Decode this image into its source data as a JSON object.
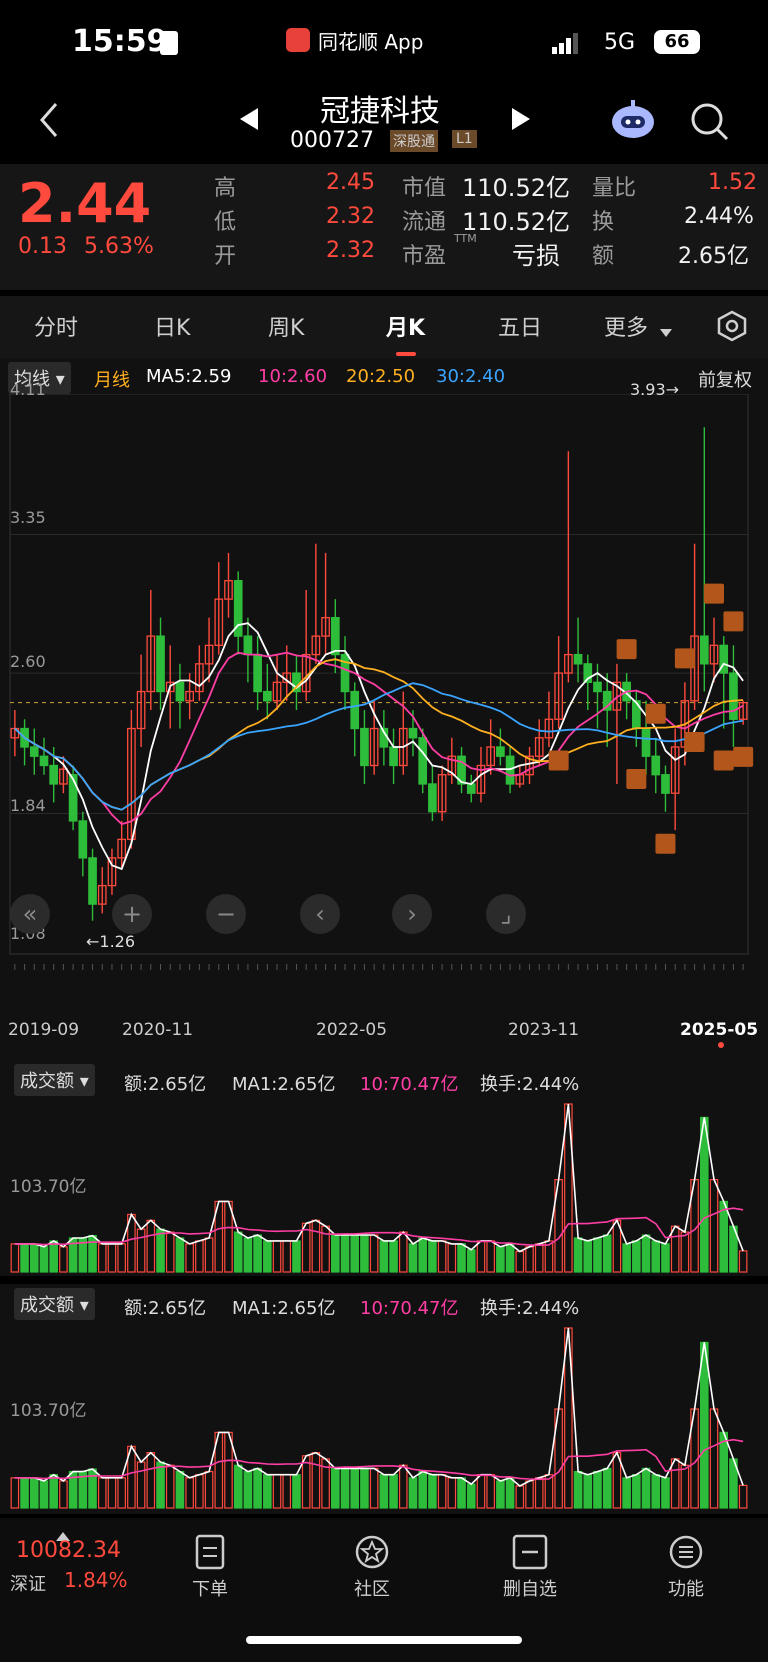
{
  "status_bar": {
    "time": "15:59",
    "app_label": "同花顺 App",
    "network": "5G",
    "battery": "66"
  },
  "header": {
    "title": "冠捷科技",
    "code": "000727",
    "tag1": "深股通",
    "tag2": "L1"
  },
  "quote": {
    "price": "2.44",
    "change": "0.13",
    "change_pct": "5.63%",
    "high_label": "高",
    "high": "2.45",
    "low_label": "低",
    "low": "2.32",
    "open_label": "开",
    "open": "2.32",
    "mktcap_label": "市值",
    "mktcap": "110.52亿",
    "float_label": "流通",
    "float": "110.52亿",
    "pe_label": "市盈",
    "pe_sup": "TTM",
    "pe": "亏损",
    "vol_ratio_label": "量比",
    "vol_ratio": "1.52",
    "turnover_label": "换",
    "turnover": "2.44%",
    "amount_label": "额",
    "amount": "2.65亿"
  },
  "tabs": [
    "分时",
    "日K",
    "周K",
    "月K",
    "五日",
    "更多"
  ],
  "active_tab": "月K",
  "chart_bar": {
    "selector": "均线",
    "period": "月线",
    "ma5": "MA5:2.59",
    "ma10": "10:2.60",
    "ma20": "20:2.50",
    "ma30": "30:2.40",
    "adjust": "前复权"
  },
  "price_axis": [
    "4.11",
    "3.35",
    "2.60",
    "1.84",
    "1.08"
  ],
  "annotations": {
    "max": "3.93→",
    "min": "←1.26"
  },
  "date_axis": [
    "2019-09",
    "2020-11",
    "2022-05",
    "2023-11",
    "2025-05"
  ],
  "volume_panels": [
    {
      "selector": "成交额",
      "amount": "额:2.65亿",
      "ma1": "MA1:2.65亿",
      "ma10": "10:70.47亿",
      "turnover": "换手:2.44%",
      "axis": "103.70亿"
    },
    {
      "selector": "成交额",
      "amount": "额:2.65亿",
      "ma1": "MA1:2.65亿",
      "ma10": "10:70.47亿",
      "turnover": "换手:2.44%",
      "axis": "103.70亿"
    }
  ],
  "bottom_nav": {
    "index_value": "10082.34",
    "index_name": "深证",
    "index_pct": "1.84%",
    "items": [
      "下单",
      "社区",
      "删自选",
      "功能"
    ]
  },
  "colors": {
    "up": "#ff4a3d",
    "down": "#2ebd3a",
    "ma5": "#ffffff",
    "ma10": "#ff3ea5",
    "ma20": "#ffb020",
    "ma30": "#3aa4ff",
    "trade": "#b3561c"
  },
  "chart_data": {
    "type": "candlestick",
    "period": "monthly",
    "x_range": [
      "2019-09",
      "2025-05"
    ],
    "ylim": [
      1.08,
      4.11
    ],
    "y_ticks": [
      4.11,
      3.35,
      2.6,
      1.84,
      1.08
    ],
    "max_label": 3.93,
    "min_label": 1.26,
    "candles": [
      [
        2.25,
        2.3,
        2.4,
        2.15
      ],
      [
        2.3,
        2.2,
        2.35,
        2.1
      ],
      [
        2.2,
        2.15,
        2.3,
        2.05
      ],
      [
        2.15,
        2.1,
        2.25,
        2.05
      ],
      [
        2.1,
        2.0,
        2.2,
        1.9
      ],
      [
        2.0,
        2.08,
        2.15,
        1.95
      ],
      [
        2.05,
        1.8,
        2.1,
        1.75
      ],
      [
        1.8,
        1.6,
        1.85,
        1.5
      ],
      [
        1.6,
        1.35,
        1.65,
        1.26
      ],
      [
        1.35,
        1.45,
        1.55,
        1.3
      ],
      [
        1.45,
        1.6,
        1.65,
        1.4
      ],
      [
        1.6,
        1.7,
        1.8,
        1.55
      ],
      [
        1.7,
        2.3,
        2.4,
        1.65
      ],
      [
        2.3,
        2.5,
        2.7,
        2.2
      ],
      [
        2.5,
        2.8,
        3.05,
        2.4
      ],
      [
        2.8,
        2.5,
        2.9,
        2.4
      ],
      [
        2.5,
        2.55,
        2.75,
        2.3
      ],
      [
        2.55,
        2.45,
        2.65,
        2.3
      ],
      [
        2.45,
        2.5,
        2.6,
        2.35
      ],
      [
        2.5,
        2.65,
        2.75,
        2.45
      ],
      [
        2.65,
        2.75,
        2.9,
        2.55
      ],
      [
        2.75,
        3.0,
        3.2,
        2.7
      ],
      [
        3.0,
        3.1,
        3.25,
        2.9
      ],
      [
        3.1,
        2.8,
        3.15,
        2.7
      ],
      [
        2.8,
        2.7,
        2.9,
        2.55
      ],
      [
        2.7,
        2.5,
        2.8,
        2.4
      ],
      [
        2.5,
        2.45,
        2.65,
        2.35
      ],
      [
        2.45,
        2.55,
        2.7,
        2.4
      ],
      [
        2.55,
        2.6,
        2.75,
        2.45
      ],
      [
        2.6,
        2.5,
        2.7,
        2.4
      ],
      [
        2.5,
        2.7,
        3.05,
        2.45
      ],
      [
        2.7,
        2.8,
        3.3,
        2.65
      ],
      [
        2.8,
        2.9,
        3.25,
        2.7
      ],
      [
        2.9,
        2.7,
        3.0,
        2.6
      ],
      [
        2.7,
        2.5,
        2.8,
        2.4
      ],
      [
        2.5,
        2.3,
        2.55,
        2.15
      ],
      [
        2.3,
        2.1,
        2.4,
        2.0
      ],
      [
        2.1,
        2.3,
        2.45,
        2.05
      ],
      [
        2.3,
        2.2,
        2.4,
        2.1
      ],
      [
        2.2,
        2.1,
        2.3,
        2.0
      ],
      [
        2.1,
        2.3,
        2.5,
        2.05
      ],
      [
        2.3,
        2.25,
        2.4,
        2.15
      ],
      [
        2.25,
        2.0,
        2.3,
        1.95
      ],
      [
        2.0,
        1.85,
        2.1,
        1.8
      ],
      [
        1.85,
        2.05,
        2.1,
        1.8
      ],
      [
        2.05,
        2.15,
        2.25,
        2.0
      ],
      [
        2.15,
        2.0,
        2.2,
        1.95
      ],
      [
        2.0,
        1.95,
        2.05,
        1.9
      ],
      [
        1.95,
        2.1,
        2.2,
        1.9
      ],
      [
        2.1,
        2.2,
        2.35,
        2.05
      ],
      [
        2.2,
        2.15,
        2.3,
        2.1
      ],
      [
        2.15,
        2.0,
        2.2,
        1.95
      ],
      [
        2.0,
        2.05,
        2.1,
        1.98
      ],
      [
        2.05,
        2.15,
        2.2,
        2.0
      ],
      [
        2.15,
        2.25,
        2.35,
        2.1
      ],
      [
        2.25,
        2.35,
        2.5,
        2.2
      ],
      [
        2.35,
        2.6,
        2.8,
        2.3
      ],
      [
        2.6,
        2.7,
        3.8,
        2.55
      ],
      [
        2.7,
        2.65,
        2.9,
        2.55
      ],
      [
        2.65,
        2.55,
        2.7,
        2.4
      ],
      [
        2.55,
        2.5,
        2.65,
        2.3
      ],
      [
        2.5,
        2.4,
        2.6,
        2.2
      ],
      [
        2.4,
        2.55,
        2.65,
        2.0
      ],
      [
        2.55,
        2.45,
        2.6,
        2.35
      ],
      [
        2.45,
        2.3,
        2.5,
        2.2
      ],
      [
        2.3,
        2.15,
        2.45,
        2.05
      ],
      [
        2.15,
        2.05,
        2.25,
        1.95
      ],
      [
        2.05,
        1.95,
        2.1,
        1.85
      ],
      [
        1.95,
        2.2,
        2.3,
        1.75
      ],
      [
        2.2,
        2.45,
        2.55,
        2.1
      ],
      [
        2.45,
        2.8,
        3.3,
        2.4
      ],
      [
        2.8,
        2.65,
        3.93,
        2.5
      ],
      [
        2.65,
        2.75,
        2.9,
        2.55
      ],
      [
        2.75,
        2.6,
        2.8,
        2.3
      ],
      [
        2.6,
        2.35,
        2.75,
        2.2
      ],
      [
        2.35,
        2.44,
        2.45,
        2.32
      ]
    ],
    "candle_fields": [
      "open",
      "close",
      "high",
      "low"
    ]
  }
}
